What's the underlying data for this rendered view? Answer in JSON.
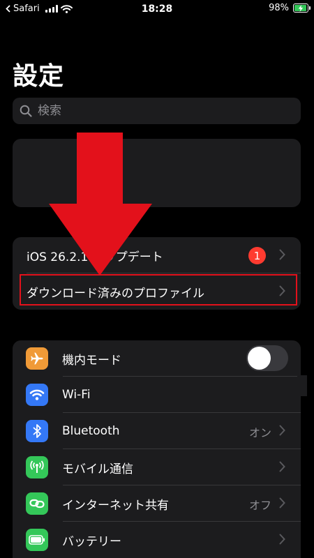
{
  "status_bar": {
    "back_app": "Safari",
    "time": "18:28",
    "battery_percent": "98%",
    "battery_level": 0.98
  },
  "page": {
    "title": "設定"
  },
  "search": {
    "placeholder": "検索"
  },
  "update_section": {
    "rows": [
      {
        "label": "iOS 26.2.1 アップデート",
        "badge": "1"
      },
      {
        "label": "ダウンロード済みのプロファイル"
      }
    ]
  },
  "settings": {
    "rows": [
      {
        "label": "機内モード",
        "icon": "airplane-icon",
        "icon_color": "#f09a37",
        "toggle_on": false
      },
      {
        "label": "Wi-Fi",
        "icon": "wifi-icon",
        "icon_color": "#3478f6"
      },
      {
        "label": "Bluetooth",
        "icon": "bluetooth-icon",
        "icon_color": "#3478f6",
        "value": "オン"
      },
      {
        "label": "モバイル通信",
        "icon": "antenna-icon",
        "icon_color": "#34c759"
      },
      {
        "label": "インターネット共有",
        "icon": "link-icon",
        "icon_color": "#34c759",
        "value": "オフ"
      },
      {
        "label": "バッテリー",
        "icon": "battery-icon",
        "icon_color": "#34c759"
      }
    ]
  },
  "colors": {
    "background": "#000000",
    "card": "#1c1c1e",
    "annotation_red": "#e3111b",
    "badge_red": "#ff3b30"
  }
}
